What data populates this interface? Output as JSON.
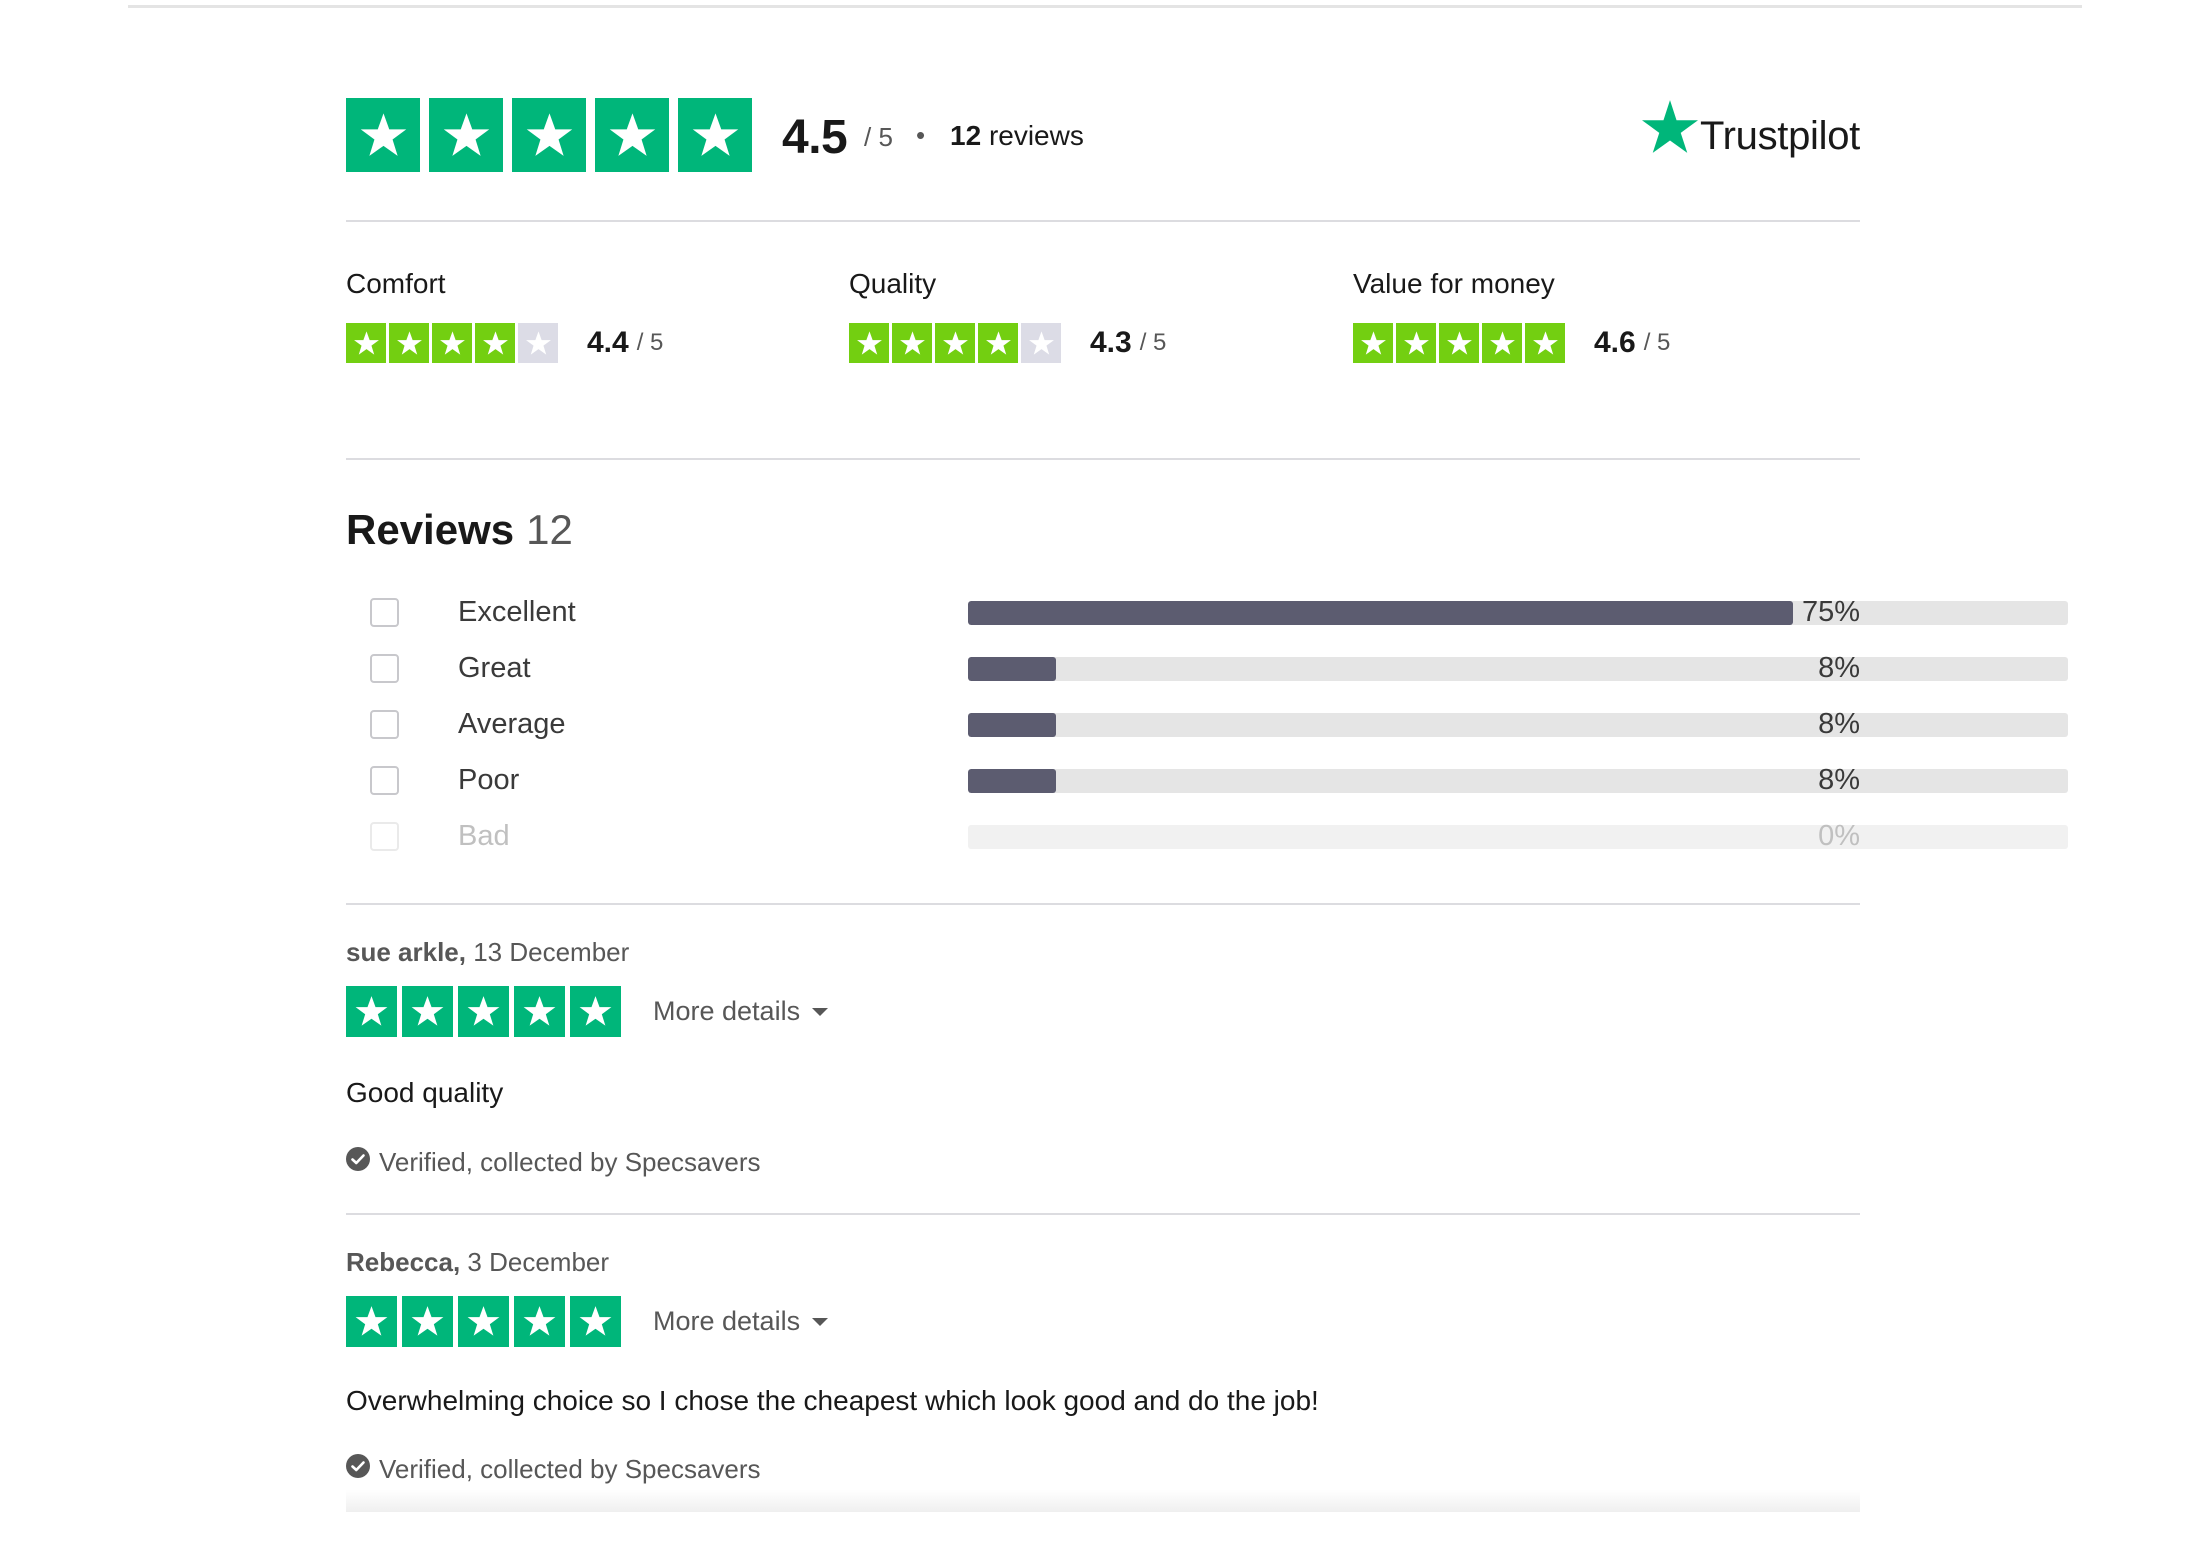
{
  "header": {
    "overall_score": "4.5",
    "overall_denominator": "/ 5",
    "separator": "•",
    "review_count_number": "12",
    "review_count_label": "reviews",
    "overall_star_count": 5,
    "brand": "Trustpilot"
  },
  "subratings": [
    {
      "label": "Comfort",
      "score": "4.4",
      "denominator": "/ 5",
      "filled_stars": 4
    },
    {
      "label": "Quality",
      "score": "4.3",
      "denominator": "/ 5",
      "filled_stars": 4
    },
    {
      "label": "Value for money",
      "score": "4.6",
      "denominator": "/ 5",
      "filled_stars": 5
    }
  ],
  "reviews_section": {
    "title": "Reviews",
    "count": "12",
    "distribution": [
      {
        "label": "Excellent",
        "percent_text": "75%",
        "percent": 75
      },
      {
        "label": "Great",
        "percent_text": "8%",
        "percent": 8
      },
      {
        "label": "Average",
        "percent_text": "8%",
        "percent": 8
      },
      {
        "label": "Poor",
        "percent_text": "8%",
        "percent": 8
      },
      {
        "label": "Bad",
        "percent_text": "0%",
        "percent": 0
      }
    ]
  },
  "reviews": [
    {
      "author": "sue arkle,",
      "date": "13 December",
      "stars": 5,
      "more_details": "More details",
      "text": "Good quality",
      "verified": "Verified, collected by Specsavers"
    },
    {
      "author": "Rebecca,",
      "date": "3 December",
      "stars": 5,
      "more_details": "More details",
      "text": "Overwhelming choice so I chose the cheapest which look good and do the job!",
      "verified": "Verified, collected by Specsavers"
    }
  ],
  "colors": {
    "trustpilot_green": "#00b67a",
    "subrating_green": "#73cf11",
    "empty_star": "#dcdce6",
    "bar_fill": "#5c5c70",
    "bar_track": "#e5e5e5"
  },
  "icons": [
    "star-icon",
    "trustpilot-star-icon",
    "checkmark-circle-icon",
    "caret-down-icon"
  ]
}
